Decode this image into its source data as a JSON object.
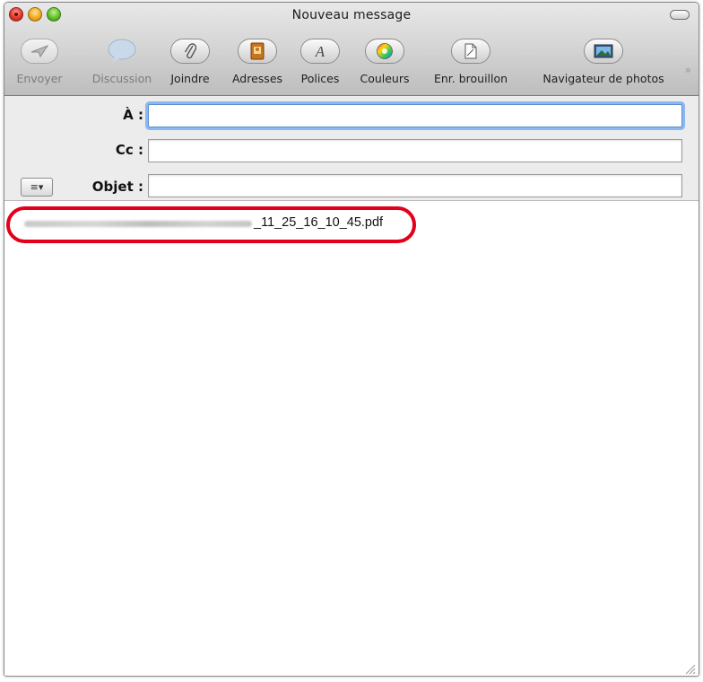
{
  "window": {
    "title": "Nouveau message"
  },
  "toolbar": {
    "items": [
      {
        "label": "Envoyer",
        "icon": "paper-plane-icon",
        "enabled": false
      },
      {
        "label": "Discussion",
        "icon": "speech-bubble-icon",
        "enabled": false
      },
      {
        "label": "Joindre",
        "icon": "paperclip-icon",
        "enabled": true
      },
      {
        "label": "Adresses",
        "icon": "address-book-icon",
        "enabled": true
      },
      {
        "label": "Polices",
        "icon": "font-letter-a-icon",
        "enabled": true
      },
      {
        "label": "Couleurs",
        "icon": "color-wheel-icon",
        "enabled": true
      },
      {
        "label": "Enr. brouillon",
        "icon": "draft-document-icon",
        "enabled": true
      },
      {
        "label": "Navigateur de photos",
        "icon": "photo-browser-icon",
        "enabled": true
      }
    ],
    "overflow": "»"
  },
  "fields": {
    "to": {
      "label": "À :",
      "value": ""
    },
    "cc": {
      "label": "Cc :",
      "value": ""
    },
    "subject": {
      "label": "Objet :",
      "value": ""
    },
    "account_menu": "≡▾"
  },
  "body": {
    "attachment_suffix": "_11_25_16_10_45.pdf"
  },
  "colors": {
    "highlight": "#e3001b",
    "focus_ring": "#8bb7ee"
  }
}
